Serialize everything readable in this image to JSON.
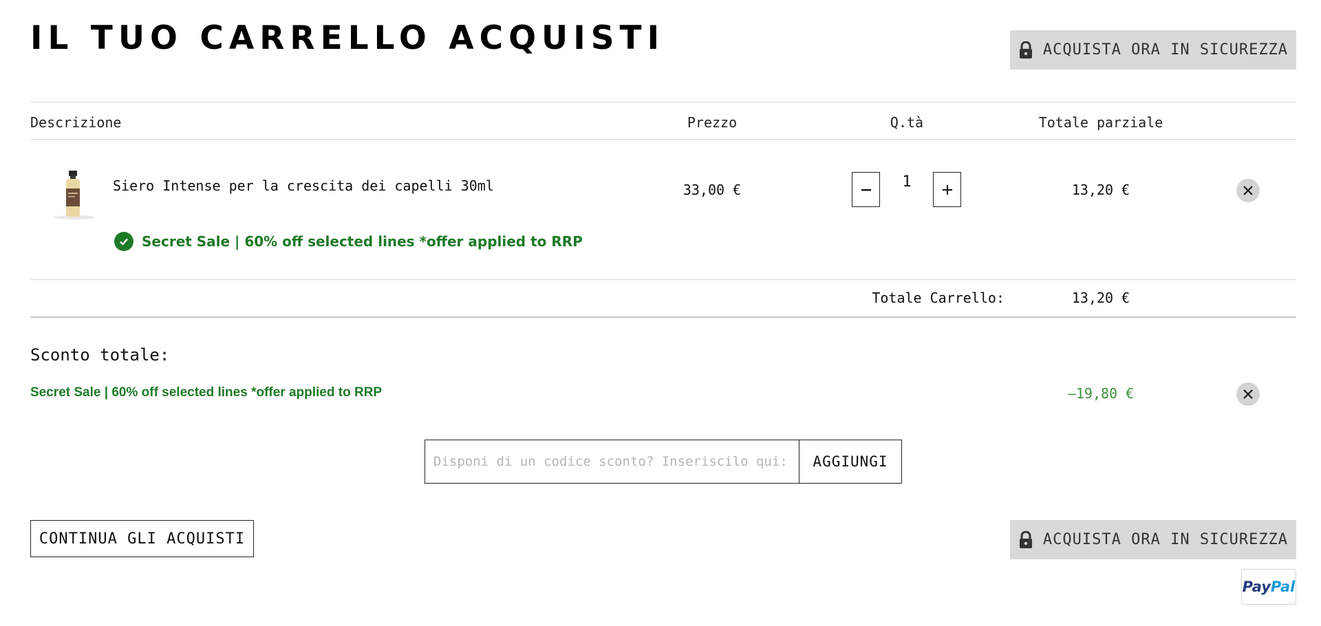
{
  "page": {
    "title": "IL TUO CARRELLO ACQUISTI",
    "secure_checkout_label": "ACQUISTA ORA IN SICUREZZA"
  },
  "table": {
    "headers": {
      "description": "Descrizione",
      "price": "Prezzo",
      "qty": "Q.tà",
      "subtotal": "Totale parziale"
    },
    "items": [
      {
        "name": "Siero Intense per la crescita dei capelli 30ml",
        "price": "33,00 €",
        "quantity": "1",
        "subtotal": "13,20 €",
        "promo": "Secret Sale | 60% off selected lines *offer applied to RRP",
        "image_icon": "serum-bottle-image"
      }
    ]
  },
  "cart_total": {
    "label": "Totale Carrello:",
    "value": "13,20 €"
  },
  "discount": {
    "title": "Sconto totale:",
    "name": "Secret Sale | 60% off selected lines *offer applied to RRP",
    "value": "–19,80 €"
  },
  "coupon": {
    "placeholder": "Disponi di un codice sconto? Inseriscilo qui:",
    "button_label": "AGGIUNGI"
  },
  "footer": {
    "continue_label": "CONTINUA GLI ACQUISTI",
    "secure_checkout_label": "ACQUISTA ORA IN SICUREZZA",
    "paypal_pay": "Pay",
    "paypal_pal": "Pal"
  },
  "colors": {
    "promo_green": "#1e7a27",
    "button_grey": "#d9d9d9",
    "paypal_dark": "#253b80",
    "paypal_light": "#179bd7"
  },
  "icons": {
    "lock": "lock-icon",
    "check": "check-circle-icon",
    "remove": "close-icon",
    "minus": "minus-icon",
    "plus": "plus-icon"
  }
}
